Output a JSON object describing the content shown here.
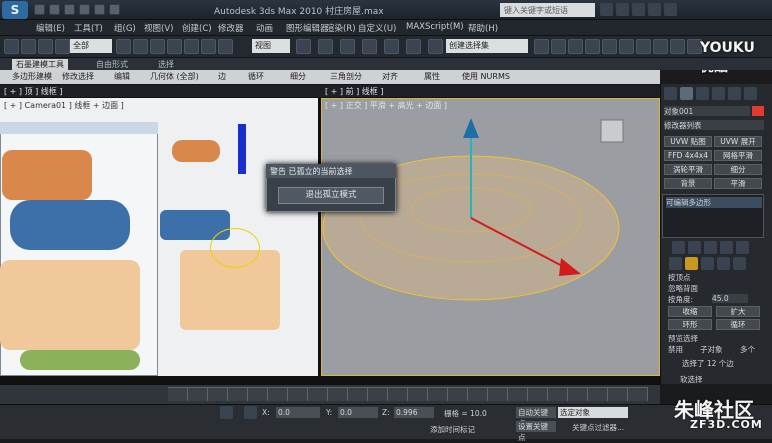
{
  "window": {
    "app_title": "Autodesk 3ds Max  2010     村庄房屋.max",
    "search_placeholder": "键入关键字或短语"
  },
  "menu": {
    "items": [
      "编辑(E)",
      "工具(T)",
      "组(G)",
      "视图(V)",
      "创建(C)",
      "修改器",
      "动画",
      "图形编辑器",
      "渲染(R)",
      "自定义(U)",
      "MAXScript(M)",
      "帮助(H)"
    ]
  },
  "toolbar": {
    "filter_value": "全部",
    "refcoord_value": "视图",
    "selection_set": "创建选择集"
  },
  "ribbon": {
    "tabs": [
      "石墨建模工具",
      "自由形式",
      "选择"
    ],
    "buttons": [
      "多边形建模",
      "修改选择",
      "编辑",
      "几何体 (全部)",
      "边",
      "循环",
      "细分",
      "三角剖分",
      "对齐",
      "属性",
      "使用 NURMS"
    ]
  },
  "viewports": {
    "left_label": "[ + ] Camera01 ] 线框 + 边面 ]",
    "right_label": "[ + ] 正交 ] 平滑 + 高光 + 边面 ]",
    "top_left_label": "[ + ] 顶 ] 线框 ]",
    "top_right_label": "[ + ] 前 ] 线框 ]"
  },
  "dialog": {
    "title": "警告  已孤立的当前选择",
    "button": "退出孤立模式"
  },
  "command_panel": {
    "object_name": "对象001",
    "modifier_list": "修改器列表",
    "buttons": [
      "UVW 贴图",
      "UVW 展开",
      "FFD 4x4x4",
      "网格平滑",
      "涡轮平滑",
      "细分",
      "背景",
      "平滑"
    ],
    "stack_item": "可编辑多边形",
    "options": [
      "按顶点",
      "忽略背面",
      "按角度:"
    ],
    "angle_value": "45.0",
    "shrink": "收缩",
    "grow": "扩大",
    "ring": "环形",
    "loop": "循环",
    "preview_title": "预览选择",
    "preview_opts": [
      "禁用",
      "子对象",
      "多个"
    ],
    "selected_count": "选择了 12 个边",
    "soft_sel": "软选择"
  },
  "statusbar": {
    "x_label": "X:",
    "x_value": "0.0",
    "y_label": "Y:",
    "y_value": "0.0",
    "z_label": "Z:",
    "z_value": "0.996",
    "grid": "栅格 = 10.0",
    "add_tag": "添加时间标记",
    "auto_key": "自动关键点",
    "selected": "选定对象",
    "set_key": "设置关键点",
    "key_filters": "关键点过滤器..."
  },
  "watermarks": {
    "youku": "YOUKU 优酷",
    "site": "朱峰社区",
    "site_url": "ZF3D.COM"
  }
}
